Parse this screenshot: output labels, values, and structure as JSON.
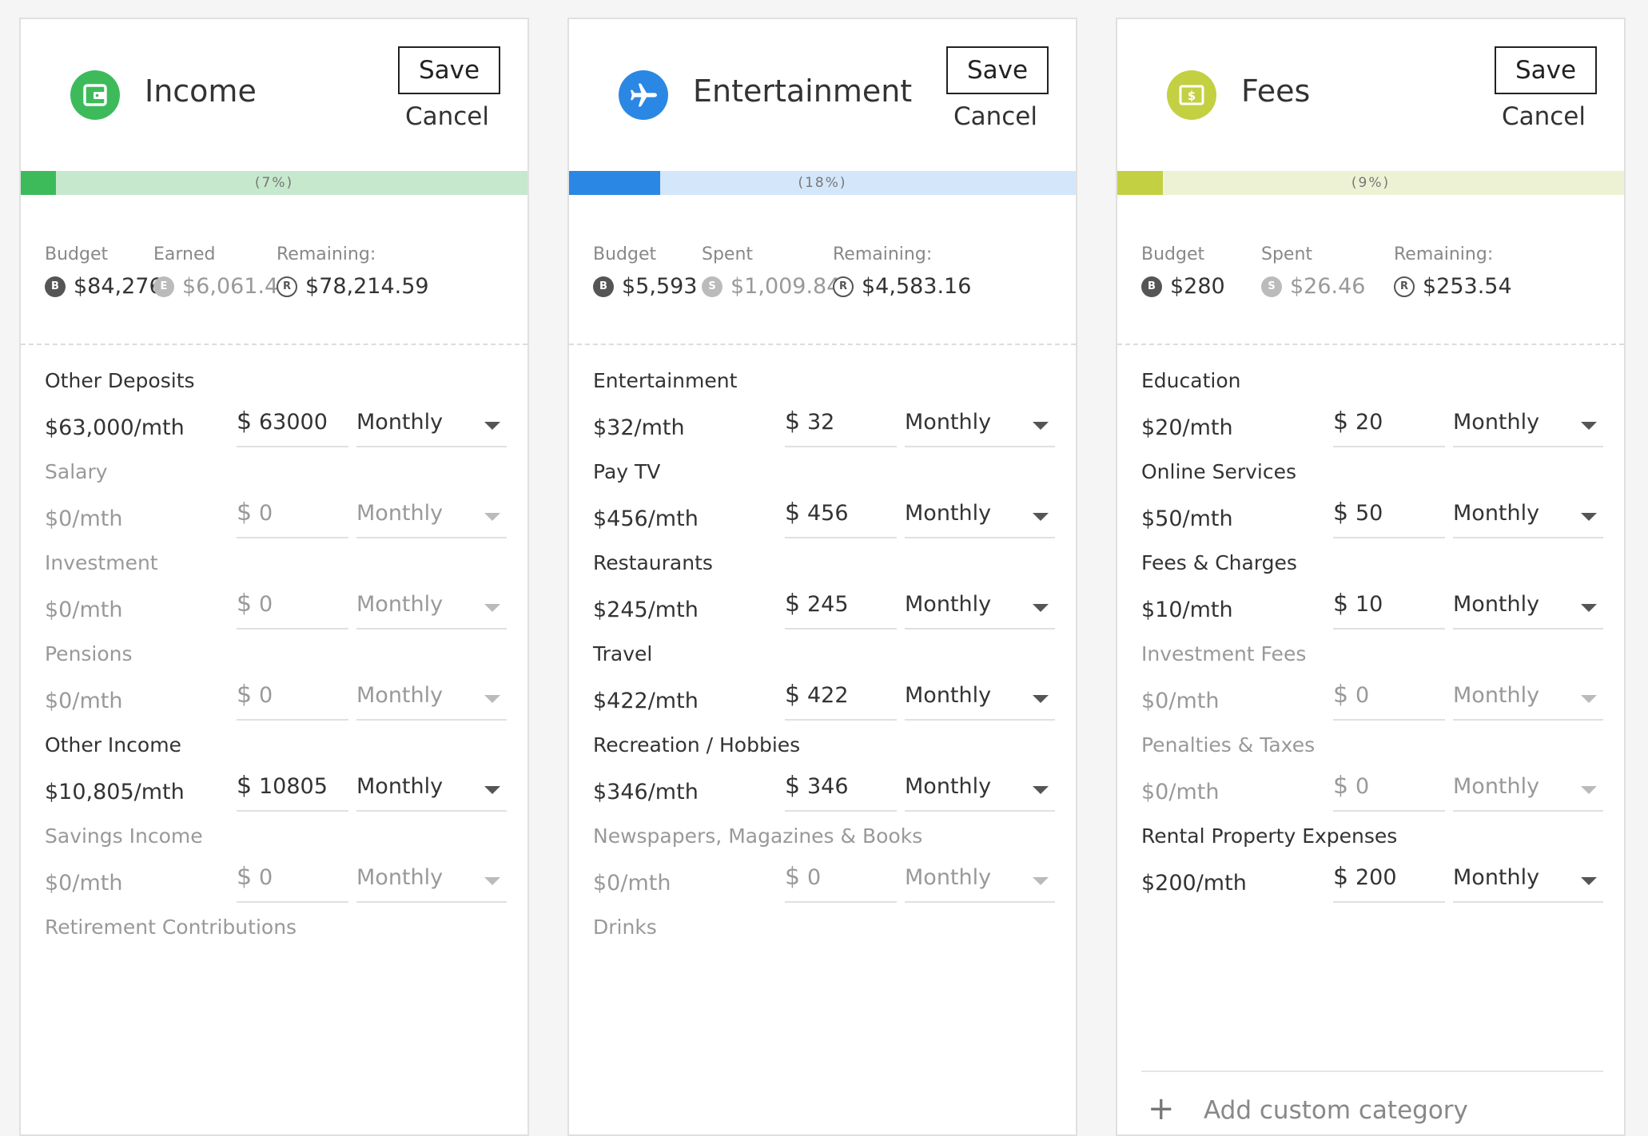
{
  "panels": [
    {
      "title": "Income",
      "icon": "wallet-icon",
      "color": "#3dbb5b",
      "track_color": "#c6e8cd",
      "progress_fraction": 0.07,
      "progress_label": "(7%)",
      "save_label": "Save",
      "cancel_label": "Cancel",
      "stats": [
        {
          "label": "Budget",
          "badge": "B",
          "value": "$84,276",
          "kind": "budget"
        },
        {
          "label": "Earned",
          "badge": "E",
          "value": "$6,061.41",
          "kind": "spent"
        },
        {
          "label": "Remaining:",
          "badge": "R",
          "value": "$78,214.59",
          "kind": "remaining"
        }
      ],
      "rows": [
        {
          "name": "Other Deposits",
          "monthly": "$63,000/mth",
          "currency": "$",
          "amount": "63000",
          "frequency": "Monthly",
          "active": true
        },
        {
          "name": "Salary",
          "monthly": "$0/mth",
          "currency": "$",
          "amount": "0",
          "frequency": "Monthly",
          "active": false
        },
        {
          "name": "Investment",
          "monthly": "$0/mth",
          "currency": "$",
          "amount": "0",
          "frequency": "Monthly",
          "active": false
        },
        {
          "name": "Pensions",
          "monthly": "$0/mth",
          "currency": "$",
          "amount": "0",
          "frequency": "Monthly",
          "active": false
        },
        {
          "name": "Other Income",
          "monthly": "$10,805/mth",
          "currency": "$",
          "amount": "10805",
          "frequency": "Monthly",
          "active": true
        },
        {
          "name": "Savings Income",
          "monthly": "$0/mth",
          "currency": "$",
          "amount": "0",
          "frequency": "Monthly",
          "active": false
        },
        {
          "name": "Retirement Contributions",
          "monthly": "",
          "currency": "",
          "amount": "",
          "frequency": "",
          "active": false
        }
      ]
    },
    {
      "title": "Entertainment",
      "icon": "airplane-icon",
      "color": "#2a87e4",
      "track_color": "#d4e6fa",
      "progress_fraction": 0.18,
      "progress_label": "(18%)",
      "save_label": "Save",
      "cancel_label": "Cancel",
      "stats": [
        {
          "label": "Budget",
          "badge": "B",
          "value": "$5,593",
          "kind": "budget"
        },
        {
          "label": "Spent",
          "badge": "S",
          "value": "$1,009.84",
          "kind": "spent"
        },
        {
          "label": "Remaining:",
          "badge": "R",
          "value": "$4,583.16",
          "kind": "remaining"
        }
      ],
      "rows": [
        {
          "name": "Entertainment",
          "monthly": "$32/mth",
          "currency": "$",
          "amount": "32",
          "frequency": "Monthly",
          "active": true
        },
        {
          "name": "Pay TV",
          "monthly": "$456/mth",
          "currency": "$",
          "amount": "456",
          "frequency": "Monthly",
          "active": true
        },
        {
          "name": "Restaurants",
          "monthly": "$245/mth",
          "currency": "$",
          "amount": "245",
          "frequency": "Monthly",
          "active": true
        },
        {
          "name": "Travel",
          "monthly": "$422/mth",
          "currency": "$",
          "amount": "422",
          "frequency": "Monthly",
          "active": true
        },
        {
          "name": "Recreation / Hobbies",
          "monthly": "$346/mth",
          "currency": "$",
          "amount": "346",
          "frequency": "Monthly",
          "active": true
        },
        {
          "name": "Newspapers, Magazines & Books",
          "monthly": "$0/mth",
          "currency": "$",
          "amount": "0",
          "frequency": "Monthly",
          "active": false
        },
        {
          "name": "Drinks",
          "monthly": "",
          "currency": "",
          "amount": "",
          "frequency": "",
          "active": false
        }
      ]
    },
    {
      "title": "Fees",
      "icon": "banknote-icon",
      "color": "#c3d041",
      "track_color": "#eef2d4",
      "progress_fraction": 0.09,
      "progress_label": "(9%)",
      "save_label": "Save",
      "cancel_label": "Cancel",
      "stats": [
        {
          "label": "Budget",
          "badge": "B",
          "value": "$280",
          "kind": "budget"
        },
        {
          "label": "Spent",
          "badge": "S",
          "value": "$26.46",
          "kind": "spent"
        },
        {
          "label": "Remaining:",
          "badge": "R",
          "value": "$253.54",
          "kind": "remaining"
        }
      ],
      "rows": [
        {
          "name": "Education",
          "monthly": "$20/mth",
          "currency": "$",
          "amount": "20",
          "frequency": "Monthly",
          "active": true
        },
        {
          "name": "Online Services",
          "monthly": "$50/mth",
          "currency": "$",
          "amount": "50",
          "frequency": "Monthly",
          "active": true
        },
        {
          "name": "Fees & Charges",
          "monthly": "$10/mth",
          "currency": "$",
          "amount": "10",
          "frequency": "Monthly",
          "active": true
        },
        {
          "name": "Investment Fees",
          "monthly": "$0/mth",
          "currency": "$",
          "amount": "0",
          "frequency": "Monthly",
          "active": false
        },
        {
          "name": "Penalties & Taxes",
          "monthly": "$0/mth",
          "currency": "$",
          "amount": "0",
          "frequency": "Monthly",
          "active": false
        },
        {
          "name": "Rental Property Expenses",
          "monthly": "$200/mth",
          "currency": "$",
          "amount": "200",
          "frequency": "Monthly",
          "active": true
        }
      ],
      "add_custom_label": "Add custom category"
    }
  ]
}
